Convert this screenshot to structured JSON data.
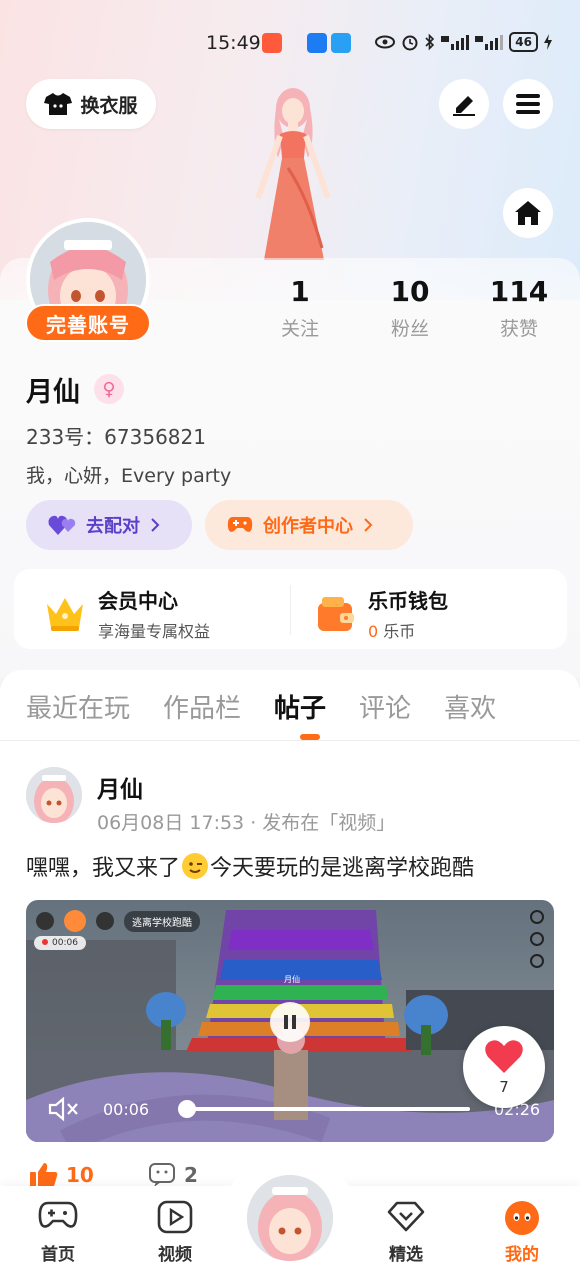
{
  "status_bar": {
    "time": "15:49",
    "battery": "46"
  },
  "header": {
    "dress_up_label": "换衣服"
  },
  "profile": {
    "complete_account_label": "完善账号",
    "stats": [
      {
        "num": "1",
        "label": "关注"
      },
      {
        "num": "10",
        "label": "粉丝"
      },
      {
        "num": "114",
        "label": "获赞"
      }
    ],
    "name": "月仙",
    "gender_symbol": "♀",
    "uid": "233号：67356821",
    "bio": "我，心妍，Every party",
    "pair_label": "去配对",
    "creator_label": "创作者中心"
  },
  "vip": {
    "member_title": "会员中心",
    "member_sub": "享海量专属权益",
    "wallet_title": "乐币钱包",
    "wallet_amount": "0",
    "wallet_unit": "乐币"
  },
  "tabs": [
    "最近在玩",
    "作品栏",
    "帖子",
    "评论",
    "喜欢"
  ],
  "active_tab": "帖子",
  "post": {
    "author": "月仙",
    "meta": "06月08日 17:53 · 发布在「视频」",
    "text_before": "嘿嘿，我又来了",
    "text_after": "今天要玩的是逃离学校跑酷",
    "video": {
      "overlay_game_tag": "逃离学校跑酷",
      "rec_time": "00:06",
      "sign_text": "月仙",
      "current_time": "00:06",
      "duration": "02:26",
      "progress": 0.0
    },
    "like_bubble_count": "7",
    "like_count": "10",
    "comment_count": "2"
  },
  "bottom_nav": [
    {
      "label": "首页",
      "icon": "gamepad-icon"
    },
    {
      "label": "视频",
      "icon": "play-icon"
    },
    {
      "label": "精选",
      "icon": "heart-diamond-icon"
    },
    {
      "label": "我的",
      "icon": "face-icon"
    }
  ],
  "colors": {
    "accent": "#ff6a16",
    "purple": "#5a3fc8"
  }
}
